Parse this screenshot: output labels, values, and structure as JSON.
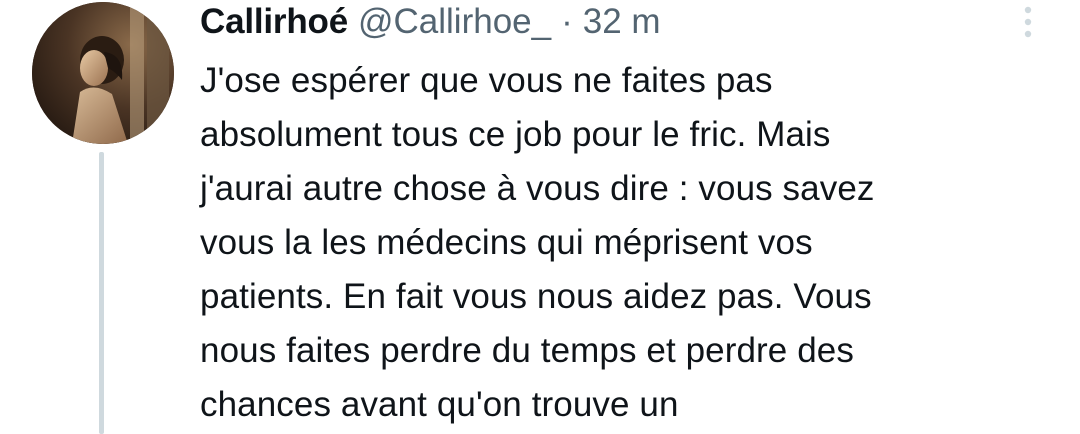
{
  "tweet": {
    "display_name": "Callirhoé",
    "handle": "@Callirhoe_",
    "separator": "·",
    "time": "32 m",
    "text": "J'ose espérer que vous ne faites pas\nabsolument tous ce job pour le fric. Mais\nj'aurai autre chose à vous dire : vous savez\nvous la les médecins qui méprisent vos\npatients. En fait vous nous aidez pas. Vous\nnous faites perdre du temps et perdre des\nchances avant qu'on trouve un"
  },
  "icons": {
    "more": "more-vertical-icon"
  },
  "colors": {
    "text": "#0f1419",
    "secondary": "#536471",
    "thread_line": "#cfd9de",
    "background": "#ffffff"
  }
}
